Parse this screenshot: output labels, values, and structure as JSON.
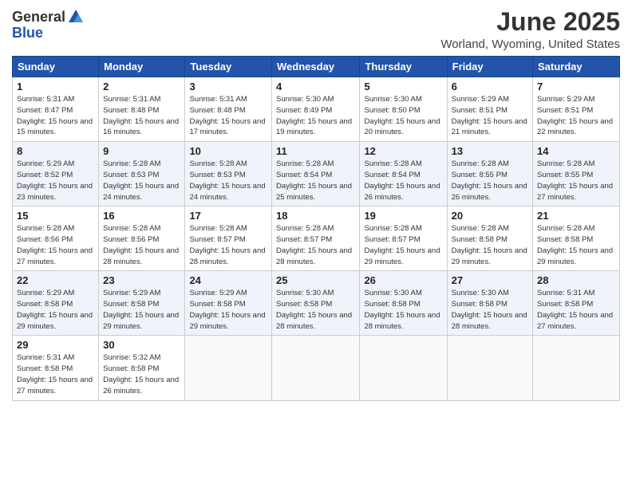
{
  "logo": {
    "general": "General",
    "blue": "Blue"
  },
  "title": "June 2025",
  "subtitle": "Worland, Wyoming, United States",
  "weekdays": [
    "Sunday",
    "Monday",
    "Tuesday",
    "Wednesday",
    "Thursday",
    "Friday",
    "Saturday"
  ],
  "weeks": [
    [
      {
        "day": "1",
        "sunrise": "5:31 AM",
        "sunset": "8:47 PM",
        "daylight": "15 hours and 15 minutes."
      },
      {
        "day": "2",
        "sunrise": "5:31 AM",
        "sunset": "8:48 PM",
        "daylight": "15 hours and 16 minutes."
      },
      {
        "day": "3",
        "sunrise": "5:31 AM",
        "sunset": "8:48 PM",
        "daylight": "15 hours and 17 minutes."
      },
      {
        "day": "4",
        "sunrise": "5:30 AM",
        "sunset": "8:49 PM",
        "daylight": "15 hours and 19 minutes."
      },
      {
        "day": "5",
        "sunrise": "5:30 AM",
        "sunset": "8:50 PM",
        "daylight": "15 hours and 20 minutes."
      },
      {
        "day": "6",
        "sunrise": "5:29 AM",
        "sunset": "8:51 PM",
        "daylight": "15 hours and 21 minutes."
      },
      {
        "day": "7",
        "sunrise": "5:29 AM",
        "sunset": "8:51 PM",
        "daylight": "15 hours and 22 minutes."
      }
    ],
    [
      {
        "day": "8",
        "sunrise": "5:29 AM",
        "sunset": "8:52 PM",
        "daylight": "15 hours and 23 minutes."
      },
      {
        "day": "9",
        "sunrise": "5:28 AM",
        "sunset": "8:53 PM",
        "daylight": "15 hours and 24 minutes."
      },
      {
        "day": "10",
        "sunrise": "5:28 AM",
        "sunset": "8:53 PM",
        "daylight": "15 hours and 24 minutes."
      },
      {
        "day": "11",
        "sunrise": "5:28 AM",
        "sunset": "8:54 PM",
        "daylight": "15 hours and 25 minutes."
      },
      {
        "day": "12",
        "sunrise": "5:28 AM",
        "sunset": "8:54 PM",
        "daylight": "15 hours and 26 minutes."
      },
      {
        "day": "13",
        "sunrise": "5:28 AM",
        "sunset": "8:55 PM",
        "daylight": "15 hours and 26 minutes."
      },
      {
        "day": "14",
        "sunrise": "5:28 AM",
        "sunset": "8:55 PM",
        "daylight": "15 hours and 27 minutes."
      }
    ],
    [
      {
        "day": "15",
        "sunrise": "5:28 AM",
        "sunset": "8:56 PM",
        "daylight": "15 hours and 27 minutes."
      },
      {
        "day": "16",
        "sunrise": "5:28 AM",
        "sunset": "8:56 PM",
        "daylight": "15 hours and 28 minutes."
      },
      {
        "day": "17",
        "sunrise": "5:28 AM",
        "sunset": "8:57 PM",
        "daylight": "15 hours and 28 minutes."
      },
      {
        "day": "18",
        "sunrise": "5:28 AM",
        "sunset": "8:57 PM",
        "daylight": "15 hours and 28 minutes."
      },
      {
        "day": "19",
        "sunrise": "5:28 AM",
        "sunset": "8:57 PM",
        "daylight": "15 hours and 29 minutes."
      },
      {
        "day": "20",
        "sunrise": "5:28 AM",
        "sunset": "8:58 PM",
        "daylight": "15 hours and 29 minutes."
      },
      {
        "day": "21",
        "sunrise": "5:28 AM",
        "sunset": "8:58 PM",
        "daylight": "15 hours and 29 minutes."
      }
    ],
    [
      {
        "day": "22",
        "sunrise": "5:29 AM",
        "sunset": "8:58 PM",
        "daylight": "15 hours and 29 minutes."
      },
      {
        "day": "23",
        "sunrise": "5:29 AM",
        "sunset": "8:58 PM",
        "daylight": "15 hours and 29 minutes."
      },
      {
        "day": "24",
        "sunrise": "5:29 AM",
        "sunset": "8:58 PM",
        "daylight": "15 hours and 29 minutes."
      },
      {
        "day": "25",
        "sunrise": "5:30 AM",
        "sunset": "8:58 PM",
        "daylight": "15 hours and 28 minutes."
      },
      {
        "day": "26",
        "sunrise": "5:30 AM",
        "sunset": "8:58 PM",
        "daylight": "15 hours and 28 minutes."
      },
      {
        "day": "27",
        "sunrise": "5:30 AM",
        "sunset": "8:58 PM",
        "daylight": "15 hours and 28 minutes."
      },
      {
        "day": "28",
        "sunrise": "5:31 AM",
        "sunset": "8:58 PM",
        "daylight": "15 hours and 27 minutes."
      }
    ],
    [
      {
        "day": "29",
        "sunrise": "5:31 AM",
        "sunset": "8:58 PM",
        "daylight": "15 hours and 27 minutes."
      },
      {
        "day": "30",
        "sunrise": "5:32 AM",
        "sunset": "8:58 PM",
        "daylight": "15 hours and 26 minutes."
      },
      null,
      null,
      null,
      null,
      null
    ]
  ],
  "labels": {
    "sunrise": "Sunrise:",
    "sunset": "Sunset:",
    "daylight": "Daylight:"
  }
}
